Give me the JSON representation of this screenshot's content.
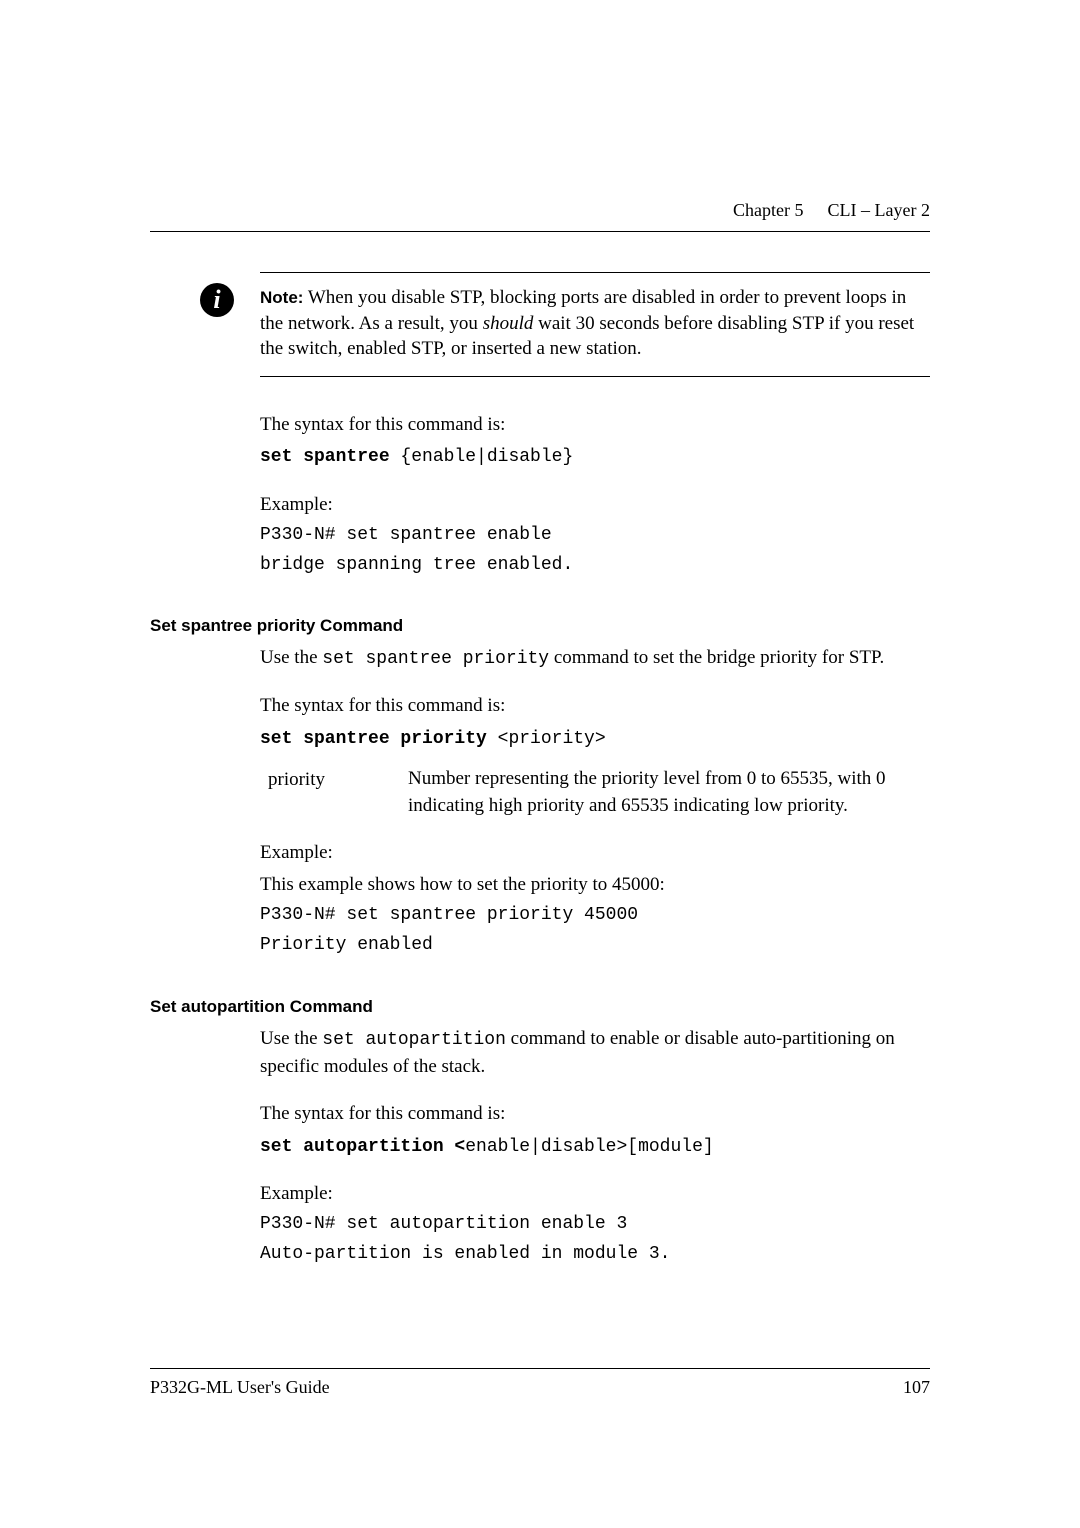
{
  "header": {
    "chapter": "Chapter 5",
    "title": "CLI – Layer 2"
  },
  "note": {
    "label": "Note:",
    "text_1": "When you disable STP, blocking ports are disabled in order to prevent loops in the network. As a result, you ",
    "should": "should",
    "text_2": " wait 30 seconds before disabling STP if you reset the switch, enabled STP, or inserted a new station."
  },
  "spantree": {
    "syntax_intro": "The syntax for this command is:",
    "cmd_bold": "set spantree",
    "cmd_rest": " {enable|disable}",
    "example_label": "Example:",
    "example_line1": "P330-N# set spantree enable",
    "example_line2": "bridge spanning tree enabled."
  },
  "priority_section": {
    "heading": "Set spantree priority Command",
    "use_pre": "Use the ",
    "use_cmd": "set spantree priority",
    "use_post": " command to set the bridge priority for STP.",
    "syntax_intro": "The syntax for this command is:",
    "cmd_bold": "set spantree priority ",
    "cmd_rest": "<priority>",
    "param_name": "priority",
    "param_desc": "Number representing the priority level from 0 to 65535, with 0 indicating high priority and 65535 indicating low priority.",
    "example_label": "Example:",
    "example_intro": "This example shows how to set the priority to 45000:",
    "example_line1": "P330-N# set spantree priority 45000",
    "example_line2": "Priority enabled"
  },
  "autopartition_section": {
    "heading": "Set autopartition Command",
    "use_pre": "Use the ",
    "use_cmd": "set autopartition",
    "use_post": " command to enable or disable auto-partitioning on specific modules of the stack.",
    "syntax_intro": "The syntax for this command is:",
    "cmd_bold": "set autopartition <",
    "cmd_rest": "enable|disable>[module]",
    "example_label": "Example:",
    "example_line1": "P330-N# set autopartition enable 3",
    "example_line2": "Auto-partition is enabled in module 3."
  },
  "footer": {
    "guide": "P332G-ML User's Guide",
    "page": "107"
  }
}
